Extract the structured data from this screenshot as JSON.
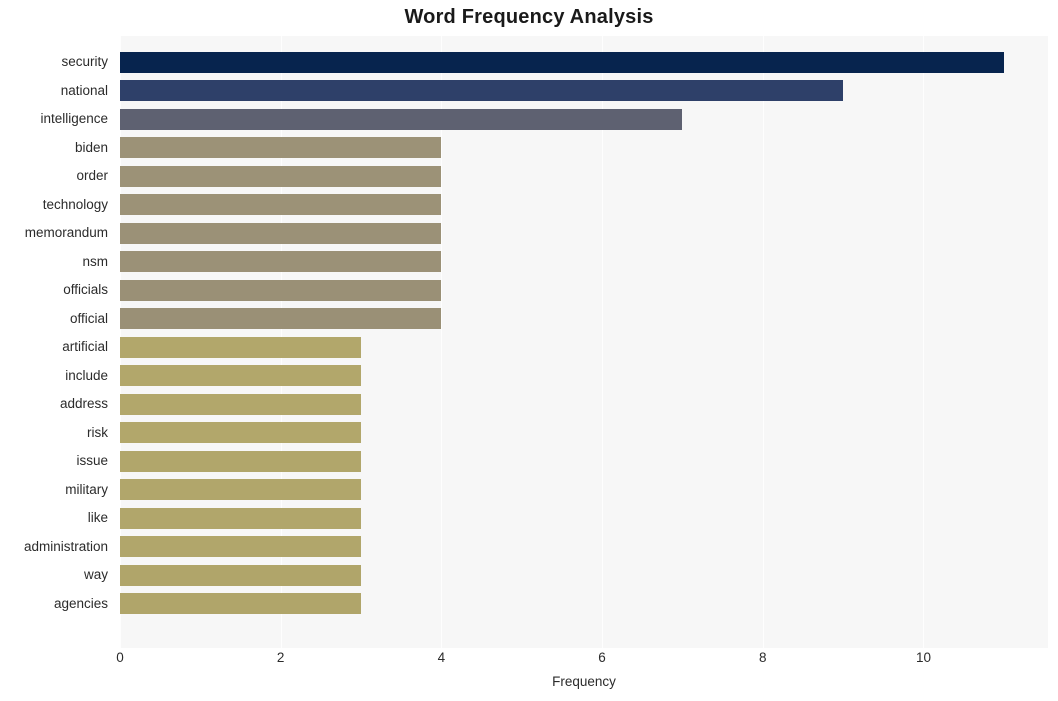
{
  "chart_data": {
    "type": "bar",
    "orientation": "horizontal",
    "title": "Word Frequency Analysis",
    "xlabel": "Frequency",
    "ylabel": "",
    "xlim": [
      0,
      11.55
    ],
    "xticks": [
      0,
      2,
      4,
      6,
      8,
      10
    ],
    "xticklabels": [
      "0",
      "2",
      "4",
      "6",
      "8",
      "10"
    ],
    "grid": true,
    "grid_axis": "x",
    "legend": false,
    "categories": [
      "security",
      "national",
      "intelligence",
      "biden",
      "order",
      "technology",
      "memorandum",
      "nsm",
      "officials",
      "official",
      "artificial",
      "include",
      "address",
      "risk",
      "issue",
      "military",
      "like",
      "administration",
      "way",
      "agencies"
    ],
    "values": [
      11,
      9,
      7,
      4,
      4,
      4,
      4,
      4,
      4,
      4,
      3,
      3,
      3,
      3,
      3,
      3,
      3,
      3,
      3,
      3
    ],
    "bar_colors": [
      "#07244e",
      "#2e4069",
      "#5e6171",
      "#9c9277",
      "#9c9277",
      "#9c9277",
      "#9b9177",
      "#9b9177",
      "#9a9076",
      "#9a9076",
      "#b2a76b",
      "#b2a76b",
      "#b2a76b",
      "#b2a76b",
      "#b1a66b",
      "#b1a66b",
      "#b1a66b",
      "#b1a66b",
      "#b0a56a",
      "#b0a56a"
    ],
    "plot_background": "#f7f7f7",
    "figure_background": "#ffffff",
    "title_color": "#1a1a1a",
    "tick_color": "#2b2b2b"
  }
}
